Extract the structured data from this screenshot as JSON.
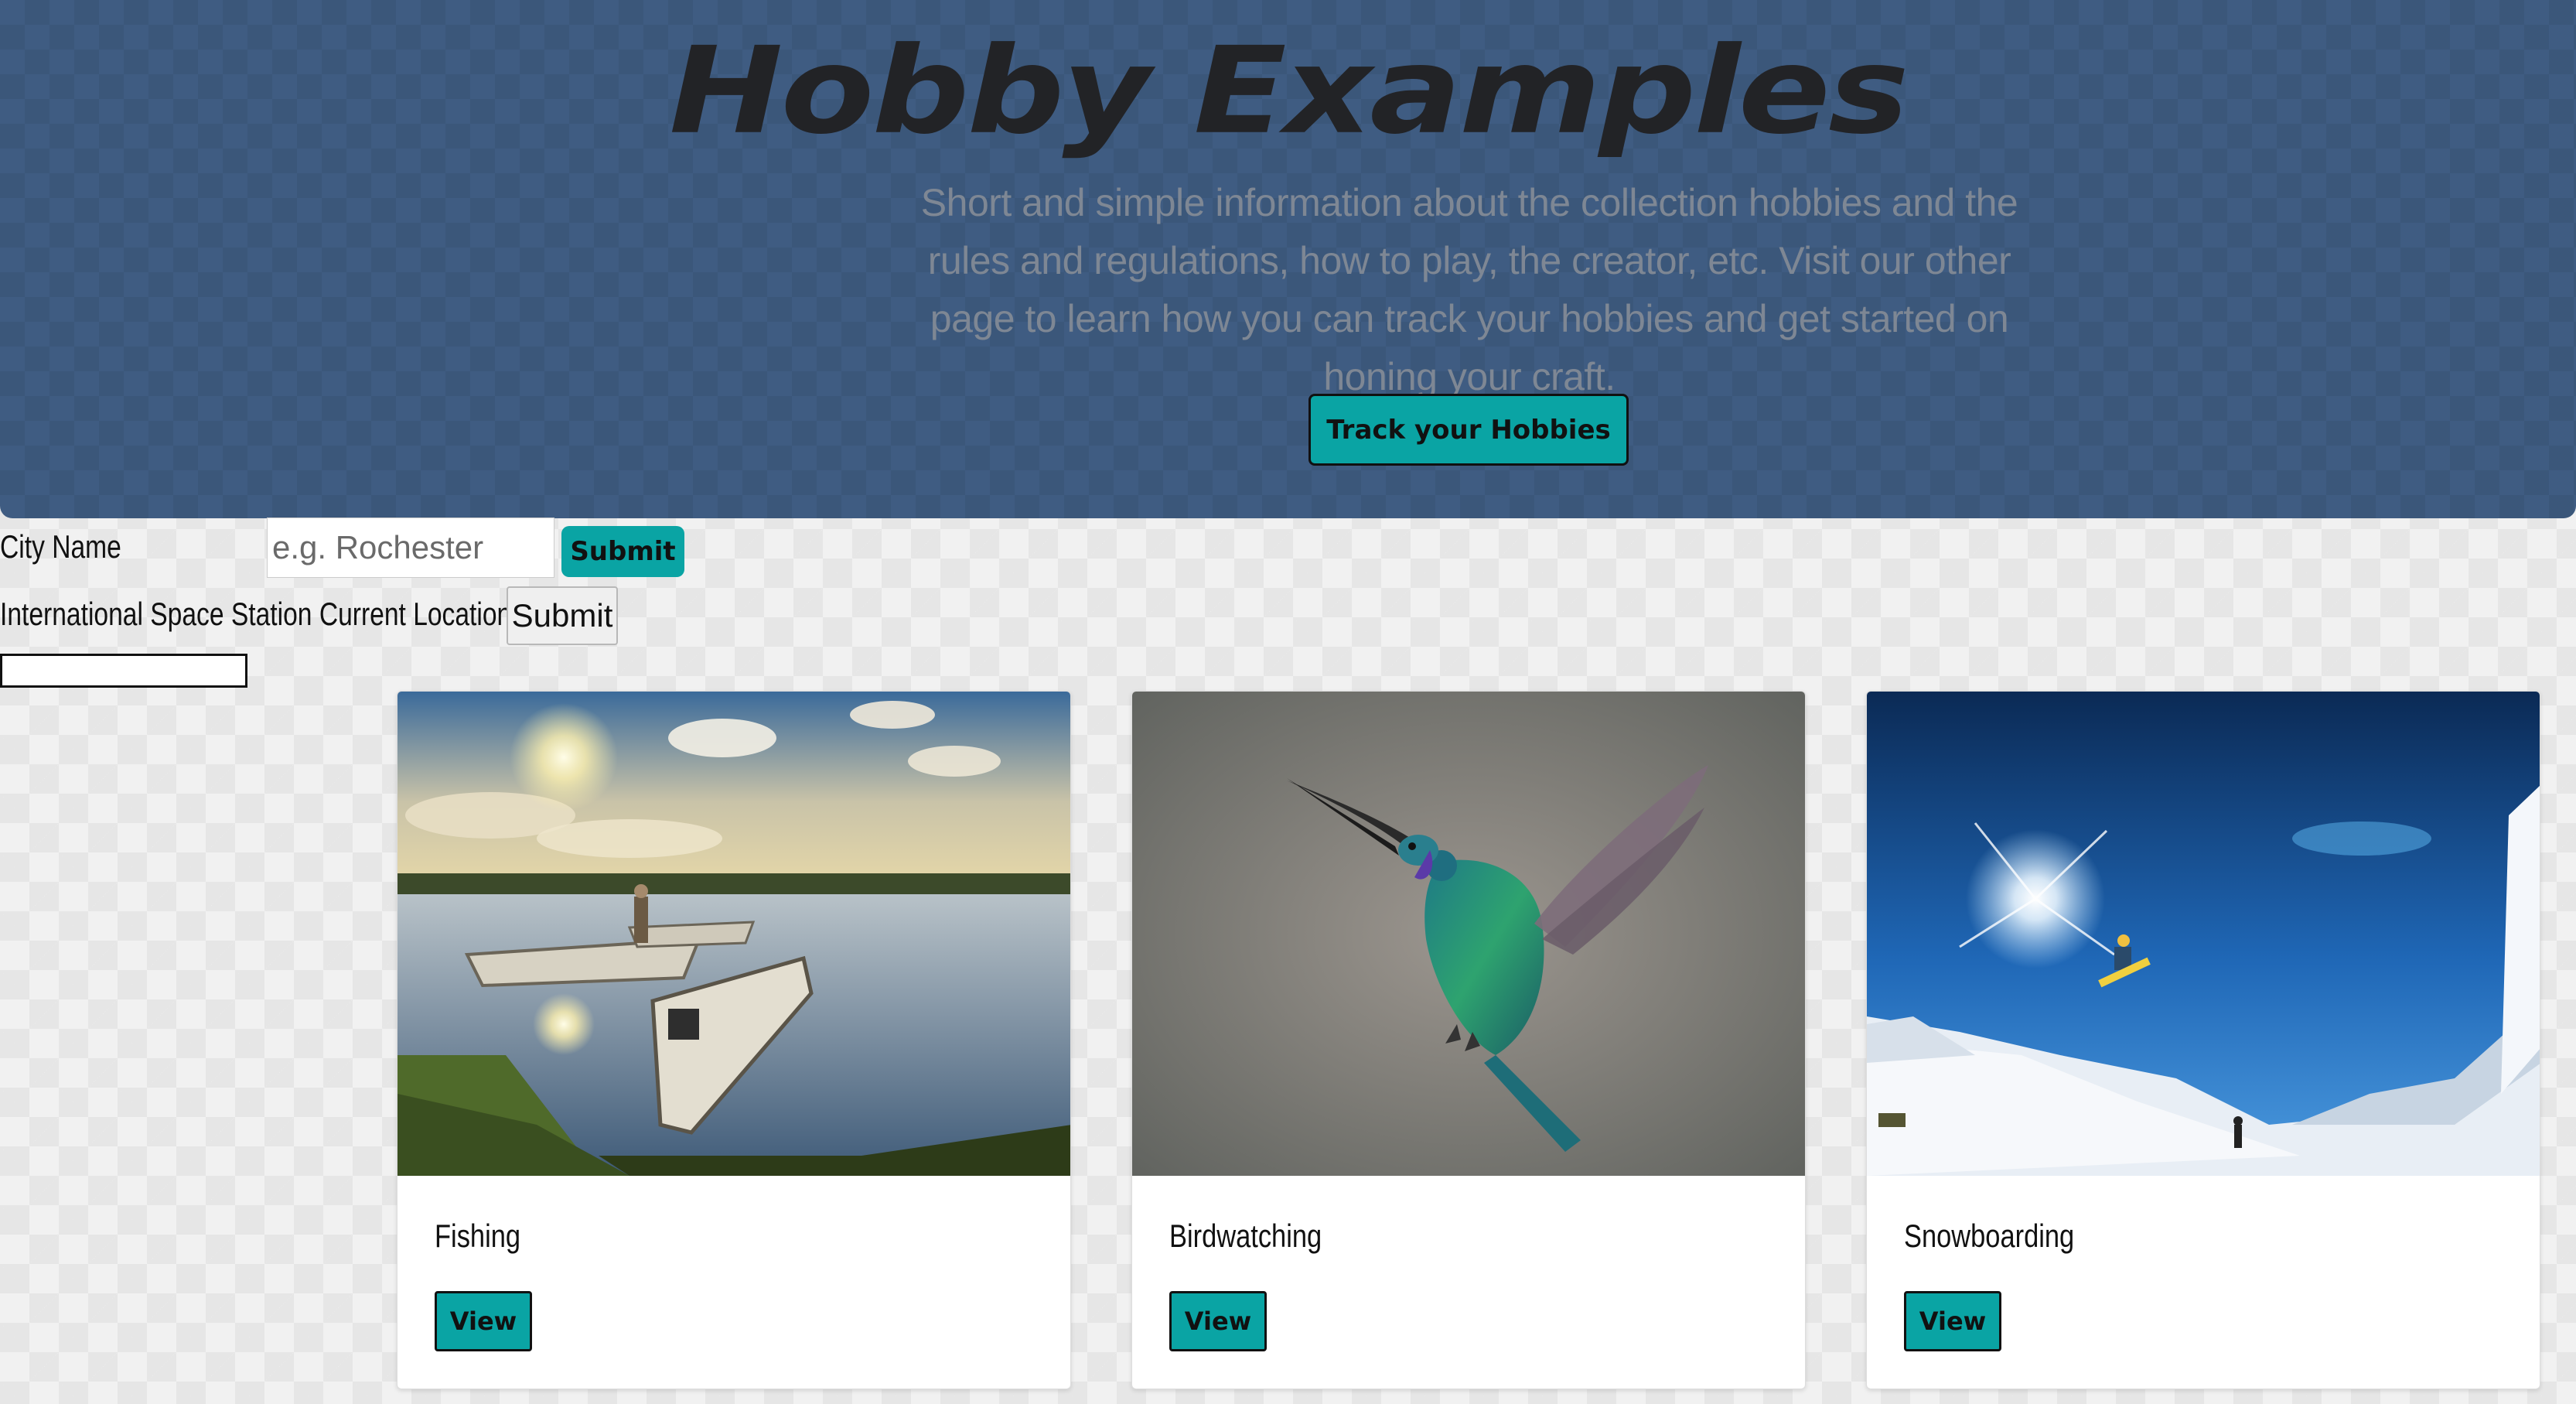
{
  "hero": {
    "title": "Hobby Examples",
    "description": "Short and simple information about the collection hobbies and the rules and regulations, how to play, the creator, etc. Visit our other page to learn how you can track your hobbies and get started on honing your craft.",
    "cta_label": "Track your Hobbies"
  },
  "weather": {
    "label": "City Name",
    "placeholder": "e.g. Rochester",
    "submit_label": "Submit"
  },
  "iss": {
    "label": "International Space Station Current Location",
    "submit_label": "Submit"
  },
  "cards": [
    {
      "title": "Fishing",
      "button_label": "View",
      "image": "lake-boats-photo"
    },
    {
      "title": "Birdwatching",
      "button_label": "View",
      "image": "hummingbird-photo"
    },
    {
      "title": "Snowboarding",
      "button_label": "View",
      "image": "snowboarder-photo"
    }
  ],
  "colors": {
    "hero_bg": "#3f5c82",
    "accent": "#0aa4a4",
    "title": "#222326",
    "muted_text": "#7e8794"
  }
}
